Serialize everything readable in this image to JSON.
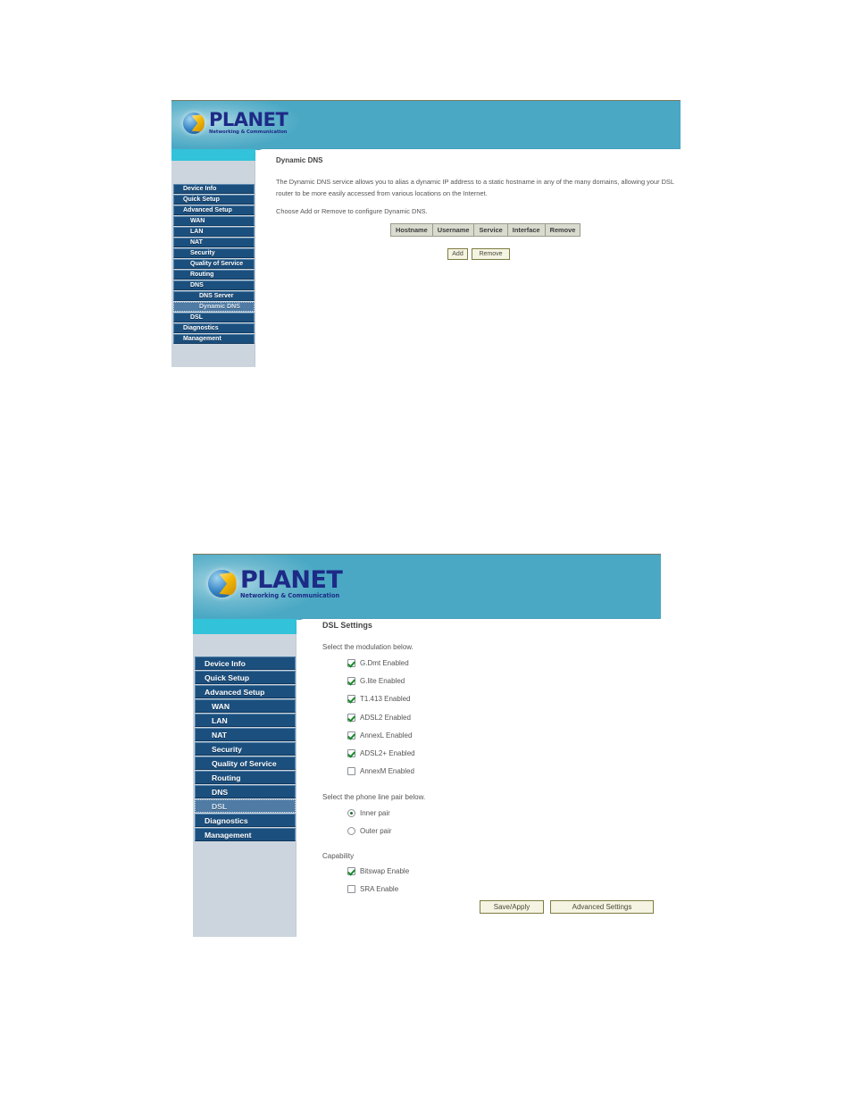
{
  "brand": {
    "name": "PLANET",
    "tagline": "Networking & Communication",
    "globe_icon": "planet-globe-icon",
    "header_color": "#4aa8c4",
    "accent_color": "#32c2da",
    "nav_color": "#1b4f7e",
    "nav_selected_color": "#4f7ba4",
    "button_face": "#f5f3e2",
    "table_header_bg": "#d9dbcf"
  },
  "screens": [
    {
      "id": "dynamic-dns",
      "page_title": "Dynamic DNS",
      "paragraphs": [
        "The Dynamic DNS service allows you to alias a dynamic IP address to a static hostname in any of the many domains, allowing your DSL router to be more easily accessed from various locations on the Internet.",
        "Choose Add or Remove to configure Dynamic DNS."
      ],
      "nav": [
        {
          "label": "Device Info",
          "level": 0,
          "selected": false
        },
        {
          "label": "Quick Setup",
          "level": 0,
          "selected": false
        },
        {
          "label": "Advanced Setup",
          "level": 0,
          "selected": false
        },
        {
          "label": "WAN",
          "level": 1,
          "selected": false
        },
        {
          "label": "LAN",
          "level": 1,
          "selected": false
        },
        {
          "label": "NAT",
          "level": 1,
          "selected": false
        },
        {
          "label": "Security",
          "level": 1,
          "selected": false
        },
        {
          "label": "Quality of Service",
          "level": 1,
          "selected": false
        },
        {
          "label": "Routing",
          "level": 1,
          "selected": false
        },
        {
          "label": "DNS",
          "level": 1,
          "selected": false
        },
        {
          "label": "DNS Server",
          "level": 2,
          "selected": false
        },
        {
          "label": "Dynamic DNS",
          "level": 2,
          "selected": true
        },
        {
          "label": "DSL",
          "level": 1,
          "selected": false
        },
        {
          "label": "Diagnostics",
          "level": 0,
          "selected": false
        },
        {
          "label": "Management",
          "level": 0,
          "selected": false
        }
      ],
      "table": {
        "columns": [
          "Hostname",
          "Username",
          "Service",
          "Interface",
          "Remove"
        ],
        "rows": []
      },
      "buttons": [
        {
          "label": "Add",
          "name": "add-button"
        },
        {
          "label": "Remove",
          "name": "remove-button"
        }
      ]
    },
    {
      "id": "dsl-settings",
      "page_title": "DSL Settings",
      "modulation_label": "Select the modulation below.",
      "modulation": [
        {
          "label": "G.Dmt Enabled",
          "checked": true
        },
        {
          "label": "G.lite Enabled",
          "checked": true
        },
        {
          "label": "T1.413 Enabled",
          "checked": true
        },
        {
          "label": "ADSL2 Enabled",
          "checked": true
        },
        {
          "label": "AnnexL Enabled",
          "checked": true
        },
        {
          "label": "ADSL2+ Enabled",
          "checked": true
        },
        {
          "label": "AnnexM Enabled",
          "checked": false
        }
      ],
      "linepair_label": "Select the phone line pair below.",
      "linepair": [
        {
          "label": "Inner pair",
          "checked": true
        },
        {
          "label": "Outer pair",
          "checked": false
        }
      ],
      "capability_label": "Capability",
      "capability": [
        {
          "label": "Bitswap Enable",
          "checked": true
        },
        {
          "label": "SRA Enable",
          "checked": false
        }
      ],
      "nav": [
        {
          "label": "Device Info",
          "level": 0,
          "selected": false
        },
        {
          "label": "Quick Setup",
          "level": 0,
          "selected": false
        },
        {
          "label": "Advanced Setup",
          "level": 0,
          "selected": false
        },
        {
          "label": "WAN",
          "level": 1,
          "selected": false
        },
        {
          "label": "LAN",
          "level": 1,
          "selected": false
        },
        {
          "label": "NAT",
          "level": 1,
          "selected": false
        },
        {
          "label": "Security",
          "level": 1,
          "selected": false
        },
        {
          "label": "Quality of Service",
          "level": 1,
          "selected": false
        },
        {
          "label": "Routing",
          "level": 1,
          "selected": false
        },
        {
          "label": "DNS",
          "level": 1,
          "selected": false
        },
        {
          "label": "DSL",
          "level": 1,
          "selected": true
        },
        {
          "label": "Diagnostics",
          "level": 0,
          "selected": false
        },
        {
          "label": "Management",
          "level": 0,
          "selected": false
        }
      ],
      "buttons": [
        {
          "label": "Save/Apply",
          "name": "save-apply-button"
        },
        {
          "label": "Advanced Settings",
          "name": "advanced-settings-button"
        }
      ]
    }
  ]
}
